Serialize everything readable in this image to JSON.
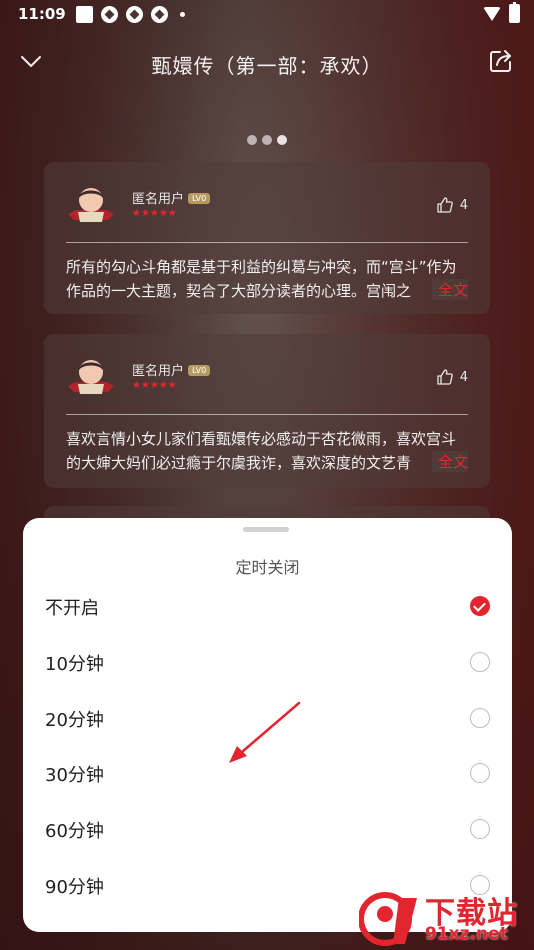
{
  "status_bar": {
    "time": "11:09"
  },
  "header": {
    "title": "甄嬛传（第一部：承欢）"
  },
  "comments": [
    {
      "user": "匿名用户",
      "level": "LV0",
      "stars": "★★★★★",
      "likes": "4",
      "text": "所有的勾心斗角都是基于利益的纠葛与冲突，而“宫斗”作为作品的一大主题，契合了大部分读者的心理。宫闱之",
      "more": "全文"
    },
    {
      "user": "匿名用户",
      "level": "LV0",
      "stars": "★★★★★",
      "likes": "4",
      "text": "喜欢言情小女儿家们看甄嬛传必感动于杏花微雨，喜欢宫斗的大婶大妈们必过瘾于尔虞我诈，喜欢深度的文艺青",
      "more": "全文"
    }
  ],
  "sheet": {
    "title": "定时关闭",
    "options": [
      {
        "label": "不开启",
        "checked": true
      },
      {
        "label": "10分钟",
        "checked": false
      },
      {
        "label": "20分钟",
        "checked": false
      },
      {
        "label": "30分钟",
        "checked": false
      },
      {
        "label": "60分钟",
        "checked": false
      },
      {
        "label": "90分钟",
        "checked": false
      }
    ]
  },
  "watermark": {
    "text": "下载站",
    "url": "91xz.net"
  },
  "colors": {
    "accent": "#e3252f",
    "badge": "#b69a5f"
  },
  "icons": [
    "chevron-down-icon",
    "share-icon",
    "thumbs-up-icon",
    "check-icon",
    "arrow-annotation"
  ]
}
